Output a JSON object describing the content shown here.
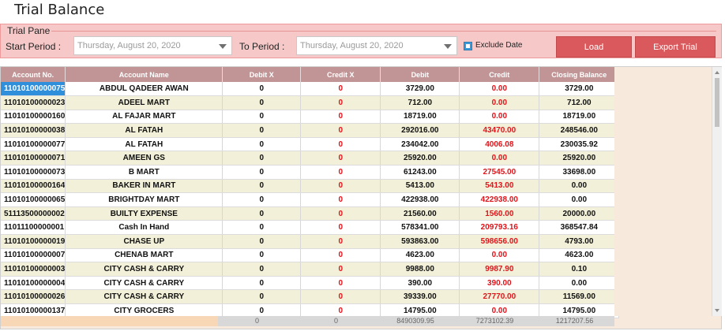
{
  "window": {
    "title": "Trial Balance"
  },
  "pane": {
    "legend": "Trial Pane",
    "start_label": "Start Period :",
    "start_value": "Thursday, August 20, 2020",
    "to_label": "To Period :",
    "to_value": "Thursday, August 20, 2020",
    "exclude_label": "Exclude Date",
    "exclude_checked": true,
    "load_label": "Load",
    "export_label": "Export Trial"
  },
  "colors": {
    "header": "#c19596",
    "accent": "#2f8fdb",
    "red": "#e0141a",
    "button": "#d9595c",
    "pane": "#f7c8c8"
  },
  "table": {
    "headers": [
      "Account No.",
      "Account Name",
      "Debit X",
      "Credit X",
      "Debit",
      "Credit",
      "Closing Balance"
    ],
    "rows": [
      [
        "11010100000075",
        "ABDUL QADEER AWAN",
        "0",
        "0",
        "3729.00",
        "0.00",
        "3729.00"
      ],
      [
        "11010100000023",
        "ADEEL MART",
        "0",
        "0",
        "712.00",
        "0.00",
        "712.00"
      ],
      [
        "11010100000160",
        "AL FAJAR MART",
        "0",
        "0",
        "18719.00",
        "0.00",
        "18719.00"
      ],
      [
        "11010100000038",
        "AL FATAH",
        "0",
        "0",
        "292016.00",
        "43470.00",
        "248546.00"
      ],
      [
        "11010100000077",
        "AL FATAH",
        "0",
        "0",
        "234042.00",
        "4006.08",
        "230035.92"
      ],
      [
        "11010100000071",
        "AMEEN GS",
        "0",
        "0",
        "25920.00",
        "0.00",
        "25920.00"
      ],
      [
        "11010100000073",
        "B MART",
        "0",
        "0",
        "61243.00",
        "27545.00",
        "33698.00"
      ],
      [
        "11010100000164",
        "BAKER IN MART",
        "0",
        "0",
        "5413.00",
        "5413.00",
        "0.00"
      ],
      [
        "11010100000065",
        "BRIGHTDAY MART",
        "0",
        "0",
        "422938.00",
        "422938.00",
        "0.00"
      ],
      [
        "51113500000002",
        "BUILTY EXPENSE",
        "0",
        "0",
        "21560.00",
        "1560.00",
        "20000.00"
      ],
      [
        "11011100000001",
        "Cash In Hand",
        "0",
        "0",
        "578341.00",
        "209793.16",
        "368547.84"
      ],
      [
        "11010100000019",
        "CHASE UP",
        "0",
        "0",
        "593863.00",
        "598656.00",
        "4793.00"
      ],
      [
        "11010100000007",
        "CHENAB MART",
        "0",
        "0",
        "4623.00",
        "0.00",
        "4623.00"
      ],
      [
        "11010100000003",
        "CITY CASH & CARRY",
        "0",
        "0",
        "9988.00",
        "9987.90",
        "0.10"
      ],
      [
        "11010100000004",
        "CITY CASH & CARRY",
        "0",
        "0",
        "390.00",
        "390.00",
        "0.00"
      ],
      [
        "11010100000026",
        "CITY CASH & CARRY",
        "0",
        "0",
        "39339.00",
        "27770.00",
        "11569.00"
      ],
      [
        "11010100000137",
        "CITY GROCERS",
        "0",
        "0",
        "14795.00",
        "0.00",
        "14795.00"
      ]
    ],
    "totals": [
      "0",
      "0",
      "8490309.95",
      "7273102.39",
      "1217207.56"
    ]
  }
}
